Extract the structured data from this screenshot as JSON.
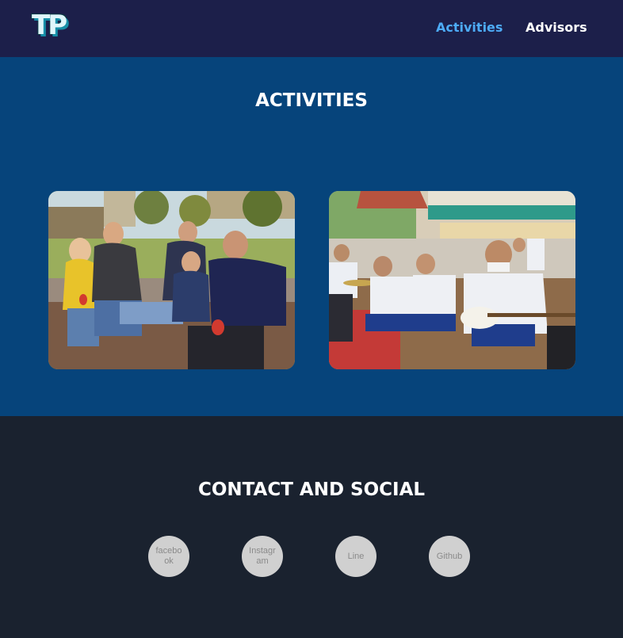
{
  "header": {
    "logo_text": "TP",
    "nav": {
      "activities": "Activities",
      "advisors": "Advisors"
    },
    "active_color": "#4dabf7"
  },
  "activities": {
    "title": "ACTIVITIES",
    "photos": [
      {
        "subject": "family group photo outdoors in park"
      },
      {
        "subject": "students playing band instruments"
      }
    ]
  },
  "contact": {
    "title": "CONTACT AND SOCIAL",
    "links": {
      "facebook": "facebook",
      "instagram": "Instagram",
      "line": "Line",
      "github": "Github"
    }
  },
  "colors": {
    "navbar": "#1c1f4a",
    "activities_bg": "#06447b",
    "contact_bg": "#1a222f"
  }
}
